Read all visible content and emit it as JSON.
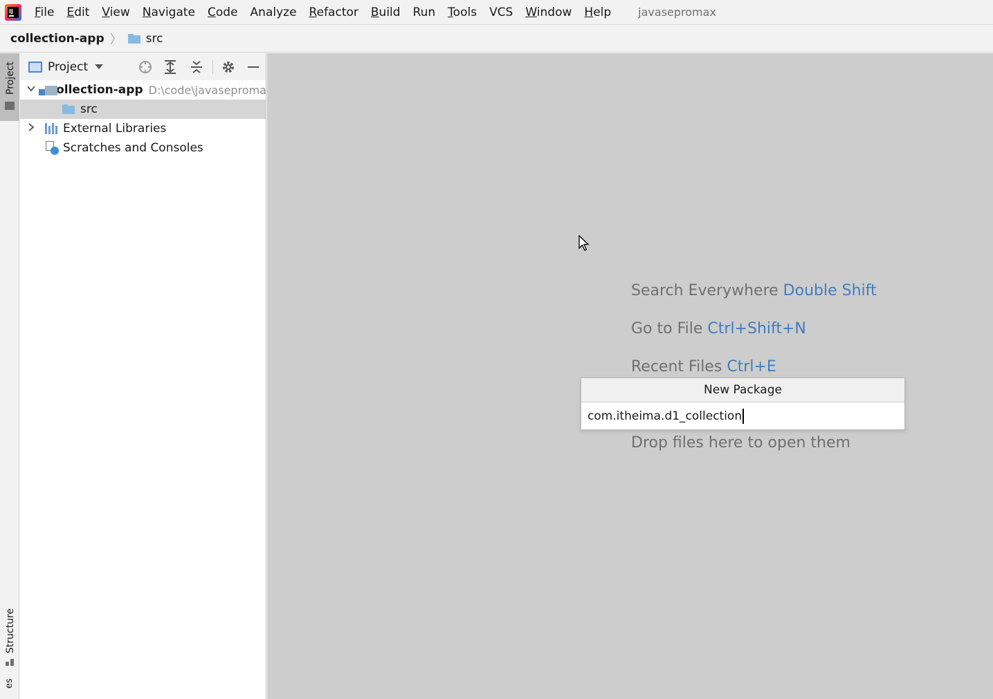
{
  "menubar": {
    "items": [
      {
        "label": "File",
        "mnemonic": "F",
        "rest": "ile"
      },
      {
        "label": "Edit",
        "mnemonic": "E",
        "rest": "dit"
      },
      {
        "label": "View",
        "mnemonic": "V",
        "rest": "iew"
      },
      {
        "label": "Navigate",
        "mnemonic": "N",
        "rest": "avigate"
      },
      {
        "label": "Code",
        "mnemonic": "C",
        "rest": "ode"
      },
      {
        "label": "Analyze",
        "mnemonic": "",
        "rest": "Analyze"
      },
      {
        "label": "Refactor",
        "mnemonic": "R",
        "rest": "efactor"
      },
      {
        "label": "Build",
        "mnemonic": "B",
        "rest": "uild"
      },
      {
        "label": "Run",
        "mnemonic": "",
        "rest": "Run"
      },
      {
        "label": "Tools",
        "mnemonic": "T",
        "rest": "ools"
      },
      {
        "label": "VCS",
        "mnemonic": "",
        "rest": "VCS"
      },
      {
        "label": "Window",
        "mnemonic": "W",
        "rest": "indow"
      },
      {
        "label": "Help",
        "mnemonic": "H",
        "rest": "elp"
      }
    ],
    "project_name": "javasepromax"
  },
  "breadcrumb": {
    "root": "collection-app",
    "separator": "〉",
    "current": "src"
  },
  "toolstrip": {
    "project_tab": "Project",
    "structure_tab": "Structure",
    "bottom_tab": "es"
  },
  "project_panel": {
    "title": "Project",
    "tree": [
      {
        "label": "collection-app",
        "hint": "D:\\code\\javasepromax",
        "expanded": true
      },
      {
        "label": "src",
        "selected": true
      },
      {
        "label": "External Libraries",
        "expanded": false
      },
      {
        "label": "Scratches and Consoles"
      }
    ]
  },
  "editor": {
    "hints": [
      {
        "text": "Search Everywhere",
        "key": "Double Shift"
      },
      {
        "text": "Go to File",
        "key": "Ctrl+Shift+N"
      },
      {
        "text": "Recent Files",
        "key": "Ctrl+E"
      },
      {
        "text": "Drop files here to open them",
        "key": ""
      }
    ]
  },
  "new_package_popup": {
    "title": "New Package",
    "value": "com.itheima.d1_collection"
  },
  "colors": {
    "accent": "#3f7dc0",
    "editor_bg": "#cdcdcd",
    "selection": "#d5d5d5",
    "folder": "#87bbe0"
  }
}
